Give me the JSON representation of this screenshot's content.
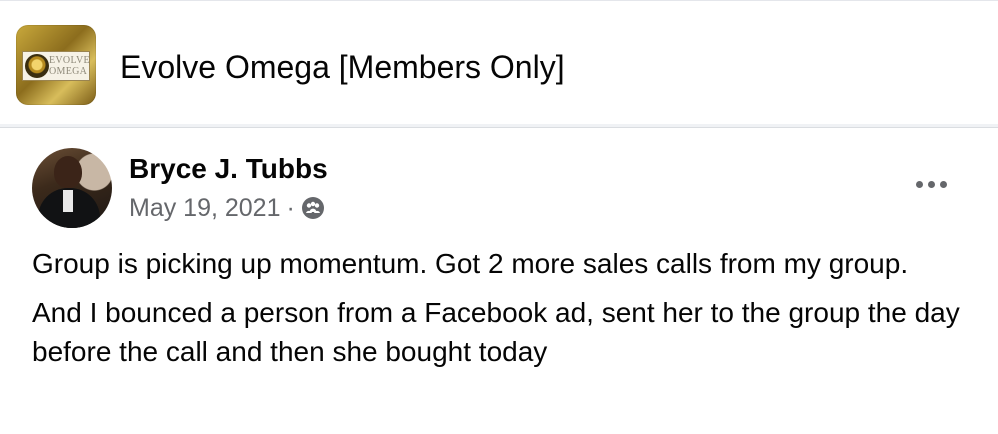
{
  "group": {
    "name": "Evolve Omega [Members Only]",
    "thumbnail_text_line1": "EVOLVE",
    "thumbnail_text_line2": "OMEGA"
  },
  "post": {
    "author": "Bryce J. Tubbs",
    "date": "May 19, 2021",
    "separator": "·",
    "audience_icon": "group-audience-icon",
    "more_icon": "more-options-icon",
    "paragraphs": [
      "Group is picking up momentum. Got 2 more sales calls from my group.",
      "And I bounced a person from a Facebook ad, sent her to the group the day before the call and then she bought today"
    ]
  },
  "colors": {
    "background": "#f0f2f5",
    "card": "#ffffff",
    "primary_text": "#050505",
    "secondary_text": "#65676b"
  }
}
